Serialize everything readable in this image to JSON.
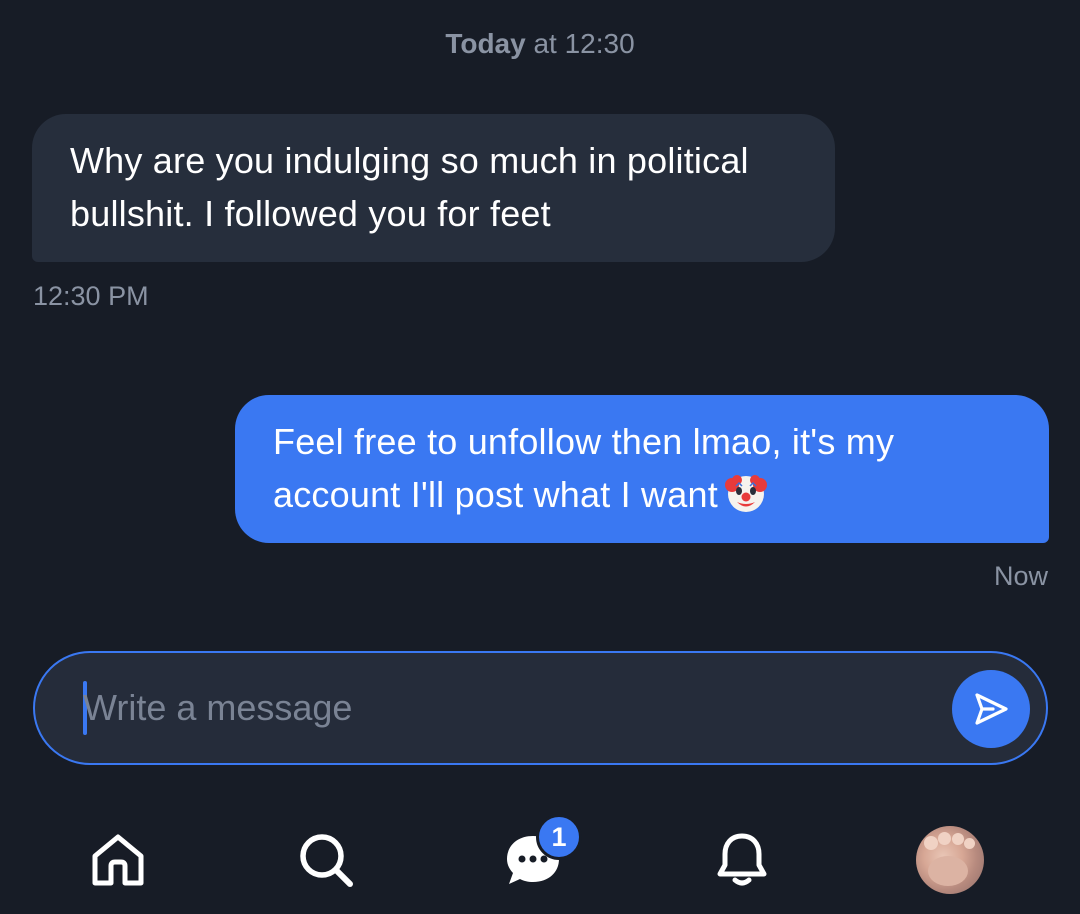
{
  "header": {
    "date_bold": "Today",
    "date_rest": " at 12:30"
  },
  "messages": [
    {
      "direction": "incoming",
      "text": "Why are you indulging so much in political bullshit. I followed you for feet",
      "time": "12:30 PM"
    },
    {
      "direction": "outgoing",
      "text": "Feel free to unfollow then lmao, it's my account I'll post what I want",
      "emoji": "clown-face-emoji",
      "time": "Now"
    }
  ],
  "composer": {
    "placeholder": "Write a message",
    "value": "",
    "send_icon": "send-icon"
  },
  "nav": {
    "items": [
      {
        "id": "home",
        "icon": "home-icon"
      },
      {
        "id": "search",
        "icon": "search-icon"
      },
      {
        "id": "messages",
        "icon": "chat-bubble-icon",
        "badge": "1"
      },
      {
        "id": "notifications",
        "icon": "bell-icon"
      },
      {
        "id": "profile",
        "icon": "avatar"
      }
    ]
  },
  "colors": {
    "background": "#171c26",
    "incoming_bubble": "#262e3c",
    "outgoing_bubble": "#3a78f2",
    "accent": "#3a78f2",
    "muted_text": "#8a93a3"
  }
}
